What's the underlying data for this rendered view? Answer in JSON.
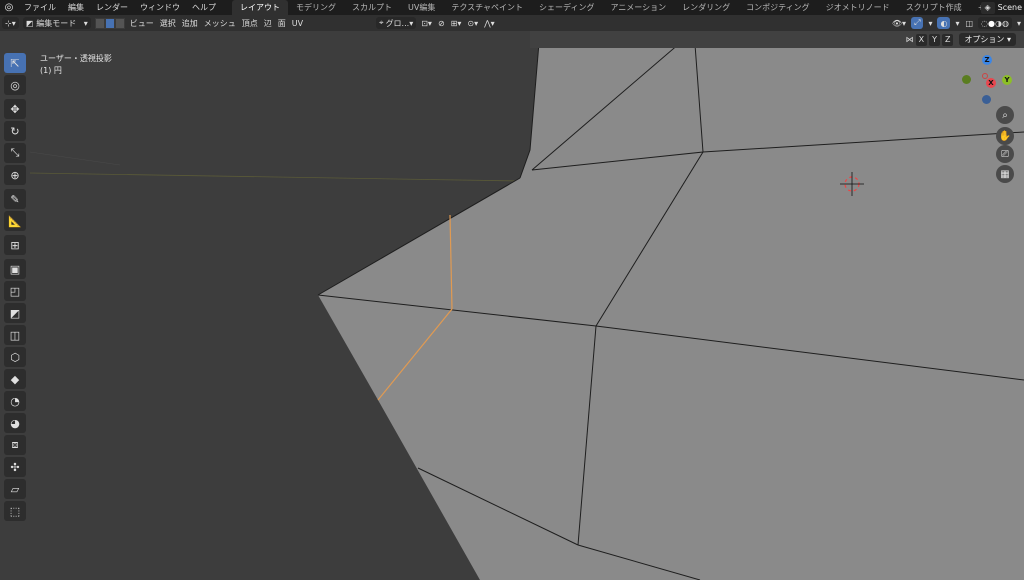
{
  "topbar": {
    "menu": [
      "ファイル",
      "編集",
      "レンダー",
      "ウィンドウ",
      "ヘルプ"
    ],
    "workspaces": [
      {
        "label": "レイアウト",
        "active": true
      },
      {
        "label": "モデリング",
        "active": false
      },
      {
        "label": "スカルプト",
        "active": false
      },
      {
        "label": "UV編集",
        "active": false
      },
      {
        "label": "テクスチャペイント",
        "active": false
      },
      {
        "label": "シェーディング",
        "active": false
      },
      {
        "label": "アニメーション",
        "active": false
      },
      {
        "label": "レンダリング",
        "active": false
      },
      {
        "label": "コンポジティング",
        "active": false
      },
      {
        "label": "ジオメトリノード",
        "active": false
      },
      {
        "label": "スクリプト作成",
        "active": false
      }
    ],
    "add_tab": "+",
    "scene_label": "Scene"
  },
  "header": {
    "mode_label": "編集モード",
    "menus": [
      "ビュー",
      "選択",
      "追加",
      "メッシュ",
      "頂点",
      "辺",
      "面",
      "UV"
    ],
    "orientation_label": "グロ..."
  },
  "viewport": {
    "overlay_title": "ユーザー・透視投影",
    "overlay_object": "(1) 円",
    "axis_buttons": [
      "X",
      "Y",
      "Z"
    ],
    "options_label": "オプション"
  },
  "gizmo": {
    "x": "X",
    "y": "Y",
    "z": "Z"
  },
  "colors": {
    "accent": "#4772b3",
    "mesh_face": "#8a8a8a",
    "selected_edge": "#e09a52",
    "axis_x": "#e8474f",
    "axis_y": "#8cbf26",
    "axis_z": "#3b86e6"
  }
}
